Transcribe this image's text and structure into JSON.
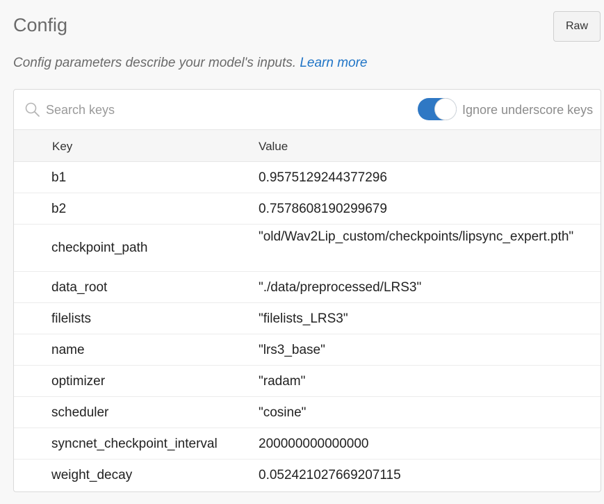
{
  "header": {
    "title": "Config",
    "raw_label": "Raw",
    "description": "Config parameters describe your model's inputs.",
    "learn_more": "Learn more"
  },
  "search": {
    "placeholder": "Search keys",
    "value": ""
  },
  "toggle": {
    "label": "Ignore underscore keys",
    "checked": true
  },
  "table": {
    "columns": [
      "Key",
      "Value"
    ],
    "rows": [
      {
        "key": "b1",
        "value": "0.9575129244377296"
      },
      {
        "key": "b2",
        "value": "0.7578608190299679"
      },
      {
        "key": "checkpoint_path",
        "value": "\"old/Wav2Lip_custom/checkpoints/lipsync_expert.pth\""
      },
      {
        "key": "data_root",
        "value": "\"./data/preprocessed/LRS3\""
      },
      {
        "key": "filelists",
        "value": "\"filelists_LRS3\""
      },
      {
        "key": "name",
        "value": "\"lrs3_base\""
      },
      {
        "key": "optimizer",
        "value": "\"radam\""
      },
      {
        "key": "scheduler",
        "value": "\"cosine\""
      },
      {
        "key": "syncnet_checkpoint_interval",
        "value": "200000000000000"
      },
      {
        "key": "weight_decay",
        "value": "0.052421027669207115"
      }
    ]
  },
  "colors": {
    "accent": "#2f78c4",
    "link": "#1f74c6",
    "muted_text": "#6a6a6a"
  }
}
